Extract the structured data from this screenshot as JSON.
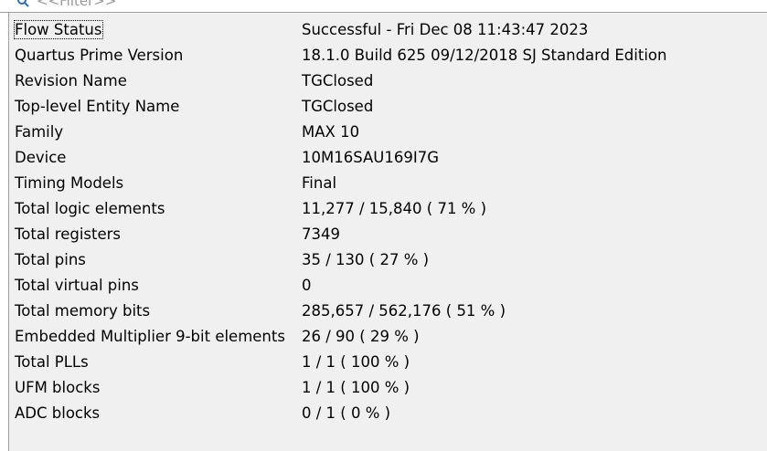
{
  "filter": {
    "placeholder": "<<Filter>>",
    "icon": "search-icon"
  },
  "summary": {
    "rows": [
      {
        "key": "Flow Status",
        "value": "Successful - Fri Dec 08 11:43:47 2023"
      },
      {
        "key": "Quartus Prime Version",
        "value": "18.1.0 Build 625 09/12/2018 SJ Standard Edition"
      },
      {
        "key": "Revision Name",
        "value": "TGClosed"
      },
      {
        "key": "Top-level Entity Name",
        "value": "TGClosed"
      },
      {
        "key": "Family",
        "value": "MAX 10"
      },
      {
        "key": "Device",
        "value": "10M16SAU169I7G"
      },
      {
        "key": "Timing Models",
        "value": "Final"
      },
      {
        "key": "Total logic elements",
        "value": "11,277 / 15,840 ( 71 % )"
      },
      {
        "key": "Total registers",
        "value": "7349"
      },
      {
        "key": "Total pins",
        "value": "35 / 130 ( 27 % )"
      },
      {
        "key": "Total virtual pins",
        "value": "0"
      },
      {
        "key": "Total memory bits",
        "value": "285,657 / 562,176 ( 51 % )"
      },
      {
        "key": "Embedded Multiplier 9-bit elements",
        "value": "26 / 90 ( 29 % )"
      },
      {
        "key": "Total PLLs",
        "value": "1 / 1 ( 100 % )"
      },
      {
        "key": "UFM blocks",
        "value": "1 / 1 ( 100 % )"
      },
      {
        "key": "ADC blocks",
        "value": "0 / 1 ( 0 % )"
      }
    ]
  }
}
